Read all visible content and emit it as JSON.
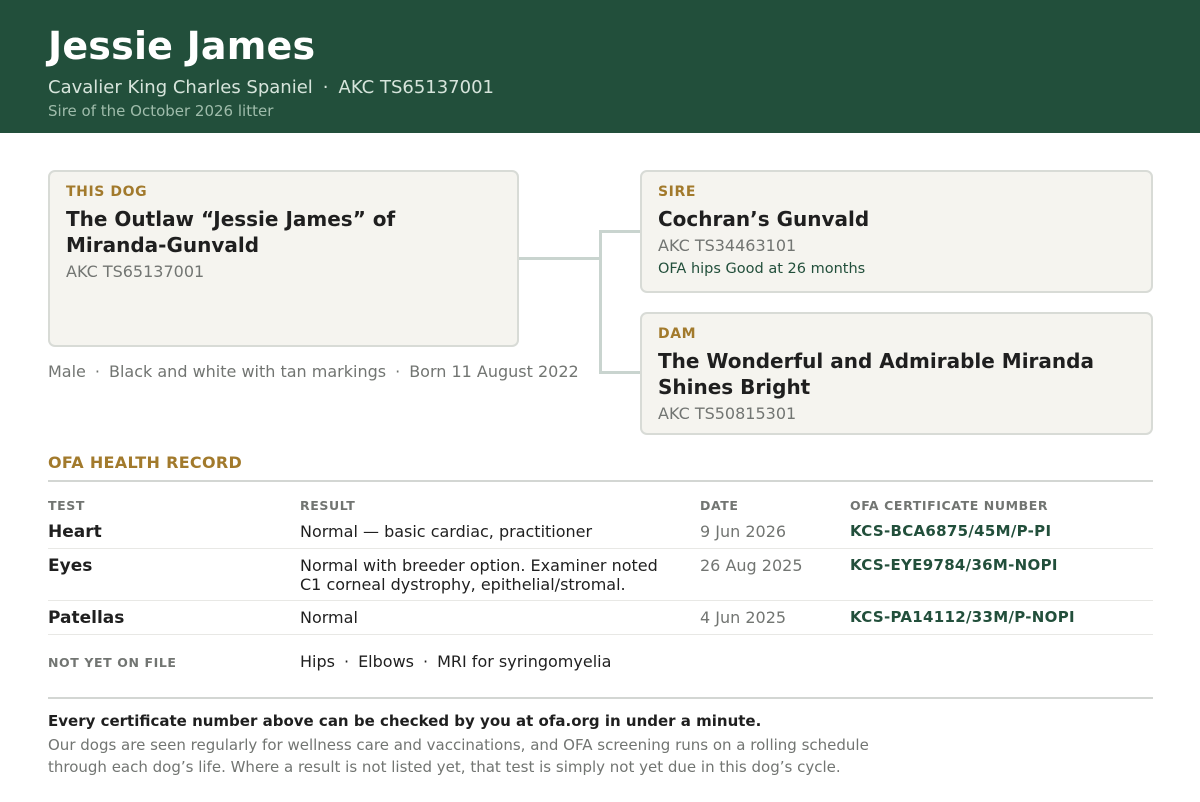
{
  "header": {
    "name": "Jessie James",
    "breed": "Cavalier King Charles Spaniel",
    "separator": "·",
    "akc": "AKC TS65137001",
    "note": "Sire of the October 2026 litter"
  },
  "pedigree": {
    "this_dog": {
      "label": "THIS DOG",
      "title": "The Outlaw “Jessie James” of Miranda-Gunvald",
      "reg": "AKC TS65137001"
    },
    "sire": {
      "label": "SIRE",
      "title": "Cochran’s Gunvald",
      "reg": "AKC TS34463101",
      "extra": "OFA hips Good at 26 months"
    },
    "dam": {
      "label": "DAM",
      "title": "The Wonderful and Admirable Miranda Shines Bright",
      "reg": "AKC TS50815301"
    }
  },
  "dog_meta": {
    "sex": "Male",
    "color": "Black and white with tan markings",
    "born": "Born 11 August 2022",
    "separator": "·"
  },
  "health": {
    "title": "OFA HEALTH RECORD",
    "columns": [
      "TEST",
      "RESULT",
      "DATE",
      "OFA CERTIFICATE NUMBER"
    ],
    "rows": [
      {
        "test": "Heart",
        "result": "Normal — basic cardiac, practitioner",
        "date": "9 Jun 2026",
        "cert": "KCS-BCA6875/45M/P-PI"
      },
      {
        "test": "Eyes",
        "result": "Normal with breeder option. Examiner noted C1 corneal dystrophy, epithelial/stromal.",
        "date": "26 Aug 2025",
        "cert": "KCS-EYE9784/36M-NOPI"
      },
      {
        "test": "Patellas",
        "result": "Normal",
        "date": "4 Jun 2025",
        "cert": "KCS-PA14112/33M/P-NOPI"
      }
    ],
    "not_on_file_label": "NOT YET ON FILE",
    "not_on_file": [
      "Hips",
      "Elbows",
      "MRI for syringomyelia"
    ],
    "separator": "·"
  },
  "footer": {
    "bold": "Every certificate number above can be checked by you at ofa.org in under a minute.",
    "text": "Our dogs are seen regularly for wellness care and vaccinations, and OFA screening runs on a rolling schedule through each dog’s life. Where a result is not listed yet, that test is simply not yet due in this dog’s cycle."
  },
  "colors": {
    "header_bg": "#224f3b",
    "accent_gold": "#a27a2c",
    "card_bg": "#f5f4ef",
    "muted": "#727572"
  }
}
